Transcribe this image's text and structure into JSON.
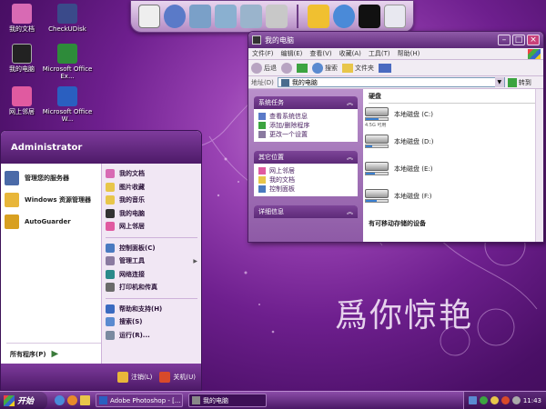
{
  "desktop": {
    "icons": [
      {
        "label": "我的文档",
        "icon": "documents-folder-icon",
        "color": "#d86ab4"
      },
      {
        "label": "CheckUDisk",
        "icon": "usb-disk-icon",
        "color": "#3a4a8a"
      },
      {
        "label": "我的电脑",
        "icon": "computer-icon",
        "color": "#222"
      },
      {
        "label": "Microsoft Office Ex...",
        "icon": "excel-icon",
        "color": "#2e8b3a"
      },
      {
        "label": "网上邻居",
        "icon": "network-icon",
        "color": "#e05aa0"
      },
      {
        "label": "Microsoft Office W...",
        "icon": "word-icon",
        "color": "#2a5fc0"
      }
    ],
    "calligraphy": "爲你惊艳"
  },
  "dock": {
    "items": [
      "slideshow-icon",
      "globe-icon",
      "folder-icon",
      "folder-open-icon",
      "folder-sync-icon",
      "tools-icon",
      "flash-icon",
      "ie-globe-icon",
      "tshirt-icon",
      "recycle-bin-icon"
    ]
  },
  "explorer": {
    "title": "我的电脑",
    "menu": [
      "文件(F)",
      "编辑(E)",
      "查看(V)",
      "收藏(A)",
      "工具(T)",
      "帮助(H)"
    ],
    "toolbar": {
      "back": "后退",
      "search": "搜索",
      "folders": "文件夹"
    },
    "address_label": "地址(D)",
    "address_value": "我的电脑",
    "go_label": "转到",
    "tasks_panel": {
      "title": "系统任务",
      "items": [
        "查看系统信息",
        "添加/删除程序",
        "更改一个设置"
      ]
    },
    "places_panel": {
      "title": "其它位置",
      "items": [
        "网上邻居",
        "我的文档",
        "控制面板"
      ]
    },
    "details_panel": {
      "title": "详细信息"
    },
    "section_header": "硬盘",
    "drives": [
      {
        "label": "本地磁盘 (C:)",
        "size": "4.5G 可用",
        "used": 0.6
      },
      {
        "label": "本地磁盘 (D:)",
        "size": "",
        "used": 0.3
      },
      {
        "label": "本地磁盘 (E:)",
        "size": "",
        "used": 0.4
      },
      {
        "label": "本地磁盘 (F:)",
        "size": "",
        "used": 0.5
      }
    ],
    "removable_header": "有可移动存储的设备"
  },
  "start_menu": {
    "user": "Administrator",
    "pinned": [
      {
        "label": "管理您的服务器",
        "color": "#4a6aa8"
      },
      {
        "label": "Windows 资源管理器",
        "color": "#e8b63a"
      },
      {
        "label": "AutoGuarder",
        "color": "#d8a020"
      }
    ],
    "all_programs": "所有程序(P)",
    "right": [
      {
        "label": "我的文档",
        "color": "#d86ab4",
        "arrow": false
      },
      {
        "label": "图片收藏",
        "color": "#e8c64a",
        "arrow": false
      },
      {
        "label": "我的音乐",
        "color": "#e8c64a",
        "arrow": false
      },
      {
        "label": "我的电脑",
        "color": "#333",
        "arrow": false
      },
      {
        "label": "网上邻居",
        "color": "#e05aa0",
        "arrow": false
      },
      {
        "label": "控制面板(C)",
        "color": "#4a7ac0",
        "arrow": false
      },
      {
        "label": "管理工具",
        "color": "#8a7aa0",
        "arrow": true
      },
      {
        "label": "网络连接",
        "color": "#2a8a8a",
        "arrow": false
      },
      {
        "label": "打印机和传真",
        "color": "#6a6a6a",
        "arrow": false
      },
      {
        "label": "帮助和支持(H)",
        "color": "#3a6ac0",
        "arrow": false
      },
      {
        "label": "搜索(S)",
        "color": "#5a8ad0",
        "arrow": false
      },
      {
        "label": "运行(R)...",
        "color": "#7a8aa0",
        "arrow": false
      }
    ],
    "logoff": "注销(L)",
    "shutdown": "关机(U)"
  },
  "taskbar": {
    "start": "开始",
    "tasks": [
      {
        "label": "Adobe Photoshop - [...",
        "active": false
      },
      {
        "label": "我的电脑",
        "active": true
      }
    ],
    "clock": "11:43"
  }
}
